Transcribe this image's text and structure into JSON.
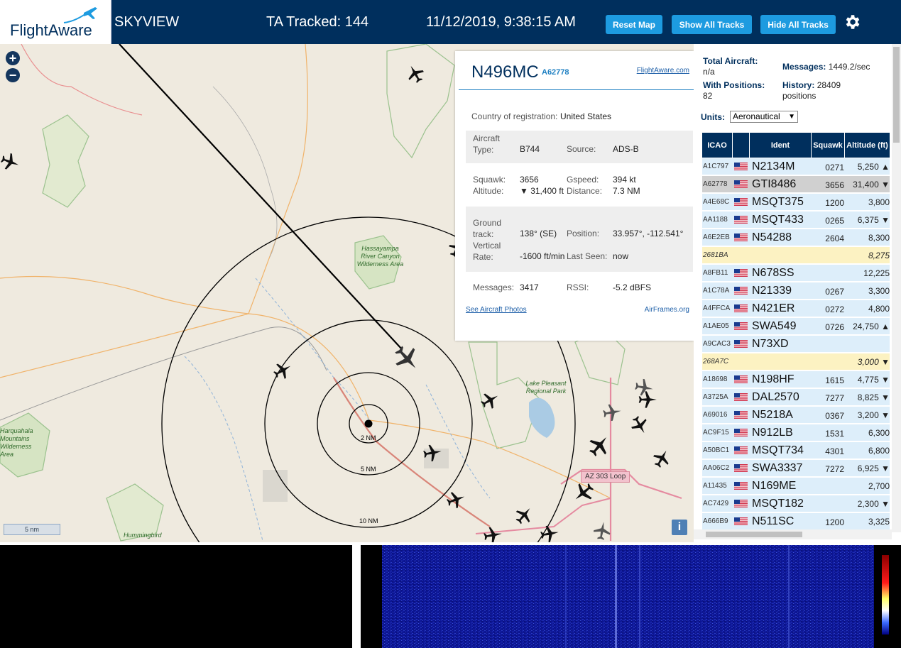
{
  "header": {
    "logo_text": "FlightAware",
    "app_title": "SKYVIEW",
    "tracked_label": "TA Tracked: 144",
    "datetime": "11/12/2019, 9:38:15 AM",
    "buttons": {
      "reset": "Reset Map",
      "show_all": "Show All Tracks",
      "hide_all": "Hide All Tracks"
    }
  },
  "map": {
    "zoom_in": "+",
    "zoom_out": "−",
    "scale": "5 nm",
    "info": "i",
    "labels": {
      "hassayampa": "Hassayampa River Canyon Wilderness Area",
      "lake_pleasant": "Lake Pleasant Regional Park",
      "harquahala": "Harquahala Mountains Wilderness Area",
      "hummingbird": "Hummingbird",
      "loop": "AZ 303 Loop"
    },
    "rings": {
      "r2": "2 NM",
      "r5": "5 NM",
      "r10": "10 NM"
    }
  },
  "selected": {
    "registration": "N496MC",
    "icao": "A62778",
    "fa_link": "FlightAware.com",
    "country_label": "Country of registration:",
    "country": "United States",
    "type_label": "Aircraft Type:",
    "type": "B744",
    "source_label": "Source:",
    "source": "ADS-B",
    "squawk_label": "Squawk:",
    "squawk": "3656",
    "gspeed_label": "Gspeed:",
    "gspeed": "394 kt",
    "altitude_label": "Altitude:",
    "altitude": "▼ 31,400 ft",
    "distance_label": "Distance:",
    "distance": "7.3 NM",
    "track_label": "Ground track:",
    "track": "138° (SE)",
    "position_label": "Position:",
    "position": "33.957°, -112.541°",
    "vrate_label": "Vertical Rate:",
    "vrate": "-1600 ft/min",
    "lastseen_label": "Last Seen:",
    "lastseen": "now",
    "messages_label": "Messages:",
    "messages": "3417",
    "rssi_label": "RSSI:",
    "rssi": "-5.2 dBFS",
    "photos_link": "See Aircraft Photos",
    "airframes_link": "AirFrames.org"
  },
  "stats": {
    "total_label": "Total Aircraft:",
    "total": "n/a",
    "messages_label": "Messages:",
    "messages": "1449.2/sec",
    "positions_label": "With Positions:",
    "positions": "82",
    "history_label": "History:",
    "history": "28409 positions",
    "units_label": "Units:",
    "units": "Aeronautical"
  },
  "table": {
    "headers": {
      "icao": "ICAO",
      "ident": "Ident",
      "squawk": "Squawk",
      "altitude": "Altitude (ft)"
    },
    "rows": [
      {
        "icao": "A1C797",
        "ident": "N2134M",
        "squawk": "0271",
        "alt": "5,250 ▲"
      },
      {
        "icao": "A62778",
        "ident": "GTI8486",
        "squawk": "3656",
        "alt": "31,400 ▼"
      },
      {
        "icao": "A4E68C",
        "ident": "MSQT375",
        "squawk": "1200",
        "alt": "3,800"
      },
      {
        "icao": "AA1188",
        "ident": "MSQT433",
        "squawk": "0265",
        "alt": "6,375 ▼"
      },
      {
        "icao": "A6E2EB",
        "ident": "N54288",
        "squawk": "2604",
        "alt": "8,300"
      },
      {
        "icao": "2681BA",
        "ident": "",
        "squawk": "",
        "alt": "8,275"
      },
      {
        "icao": "A8FB11",
        "ident": "N678SS",
        "squawk": "",
        "alt": "12,225"
      },
      {
        "icao": "A1C78A",
        "ident": "N21339",
        "squawk": "0267",
        "alt": "3,300"
      },
      {
        "icao": "A4FFCA",
        "ident": "N421ER",
        "squawk": "0272",
        "alt": "4,800"
      },
      {
        "icao": "A1AE05",
        "ident": "SWA549",
        "squawk": "0726",
        "alt": "24,750 ▲"
      },
      {
        "icao": "A9CAC3",
        "ident": "N73XD",
        "squawk": "",
        "alt": ""
      },
      {
        "icao": "268A7C",
        "ident": "",
        "squawk": "",
        "alt": "3,000 ▼"
      },
      {
        "icao": "A18698",
        "ident": "N198HF",
        "squawk": "1615",
        "alt": "4,775 ▼"
      },
      {
        "icao": "A3725A",
        "ident": "DAL2570",
        "squawk": "7277",
        "alt": "8,825 ▼"
      },
      {
        "icao": "A69016",
        "ident": "N5218A",
        "squawk": "0367",
        "alt": "3,200 ▼"
      },
      {
        "icao": "AC9F15",
        "ident": "N912LB",
        "squawk": "1531",
        "alt": "6,300"
      },
      {
        "icao": "A50BC1",
        "ident": "MSQT734",
        "squawk": "4301",
        "alt": "6,800"
      },
      {
        "icao": "AA06C2",
        "ident": "SWA3337",
        "squawk": "7272",
        "alt": "6,925 ▼"
      },
      {
        "icao": "A11435",
        "ident": "N169ME",
        "squawk": "",
        "alt": "2,700"
      },
      {
        "icao": "AC7429",
        "ident": "MSQT182",
        "squawk": "",
        "alt": "2,300 ▼"
      },
      {
        "icao": "A666B9",
        "ident": "N511SC",
        "squawk": "1200",
        "alt": "3,325"
      },
      {
        "icao": "",
        "ident": "",
        "squawk": "",
        "alt": ""
      }
    ]
  },
  "colors": {
    "header_bg": "#002f5d",
    "button": "#1d9be0",
    "row_bg": "#ddeefa",
    "row_selected": "#d0d0d0",
    "row_mlat": "#fcf2c2"
  }
}
